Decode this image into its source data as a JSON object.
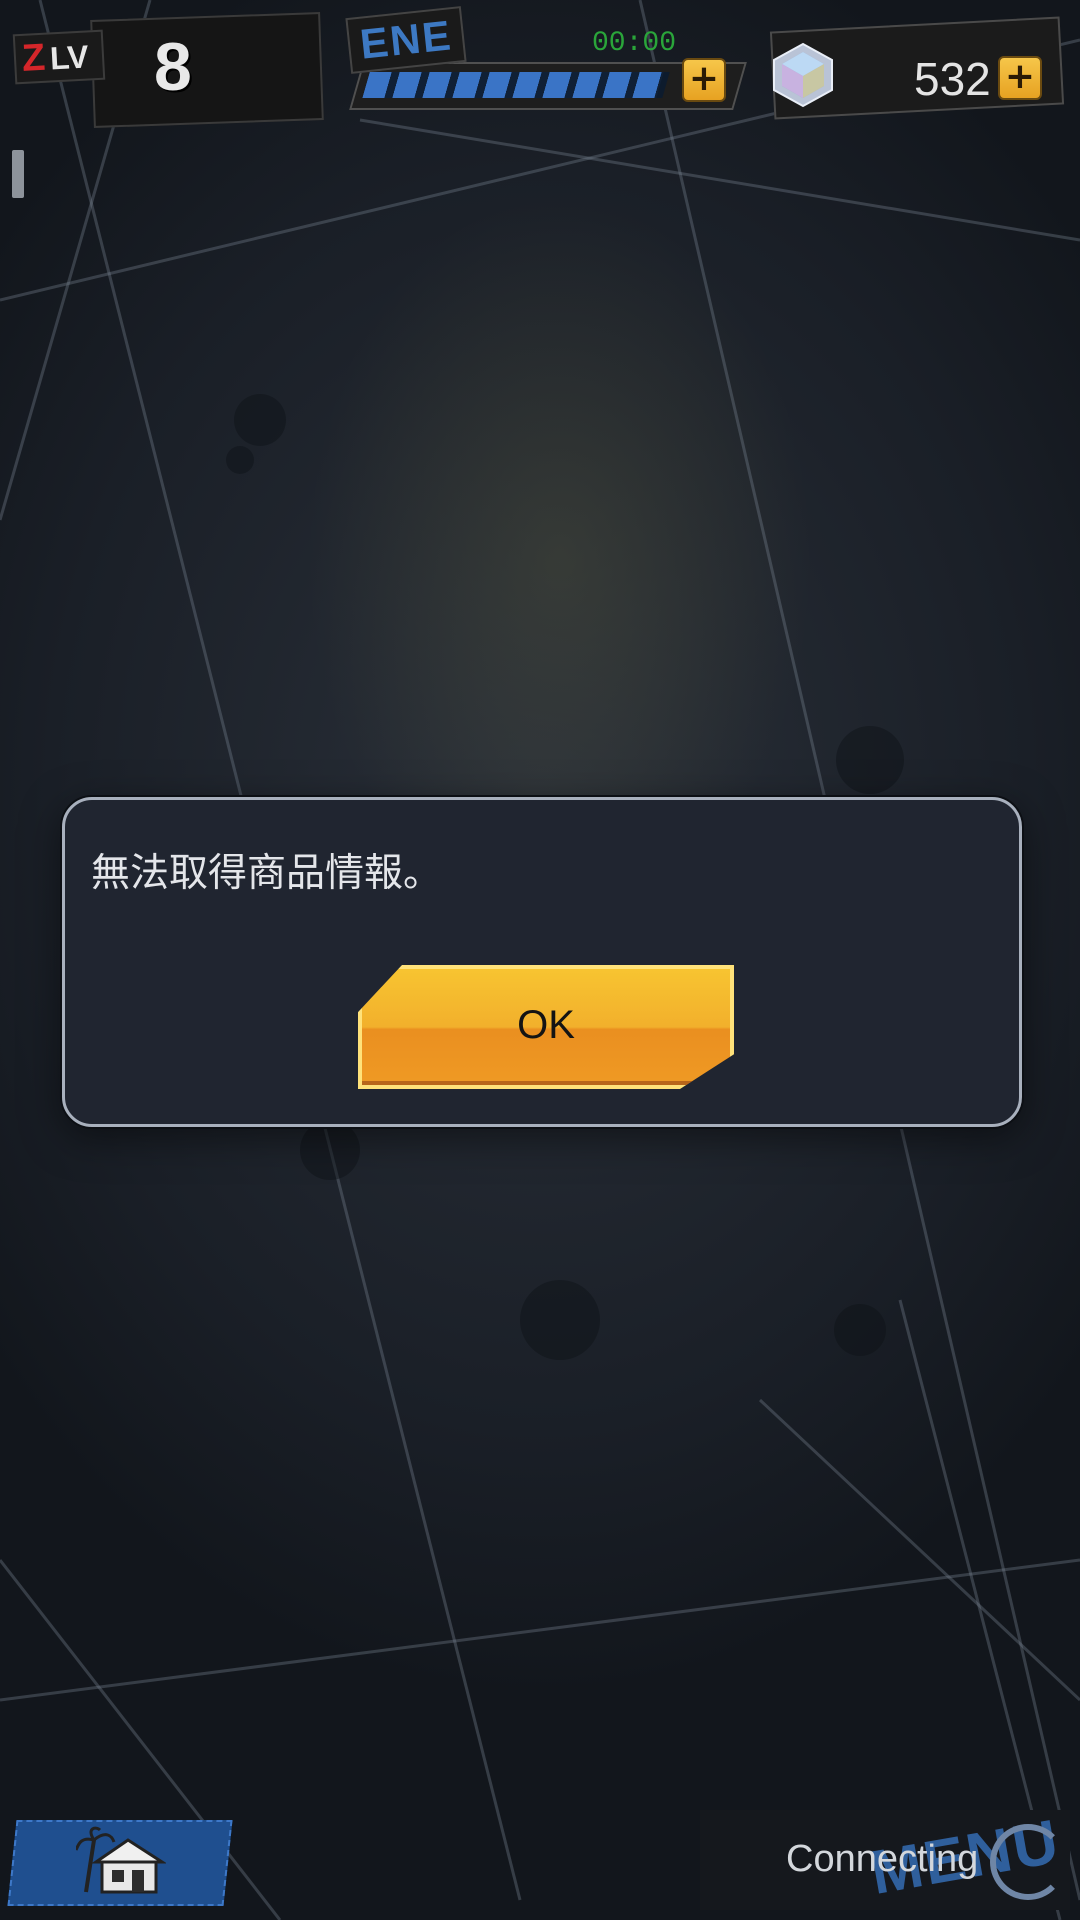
{
  "hud": {
    "level_badge": "Z",
    "level_label": "LV",
    "level_value": "8",
    "energy_label": "ENE",
    "energy_timer": "00:00",
    "energy_fill_fraction": 0.98,
    "energy_plus": "+",
    "gem_count": "532",
    "gem_plus": "+"
  },
  "dialog": {
    "message": "無法取得商品情報。",
    "ok_label": "OK"
  },
  "bottom": {
    "status": "Connecting",
    "menu_label": "MENU"
  },
  "colors": {
    "accent_orange": "#f2b02c",
    "energy_blue": "#3a74c6",
    "timer_green": "#2aa53a",
    "dialog_bg": "#202530"
  },
  "icons": [
    "gem-icon",
    "plus-icon",
    "home-icon",
    "loading-spinner-icon"
  ]
}
